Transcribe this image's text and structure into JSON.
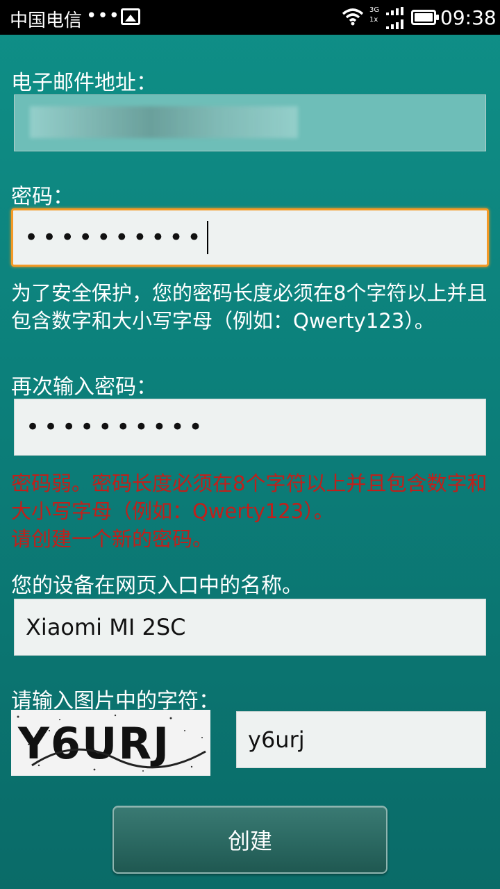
{
  "status_bar": {
    "carrier": "中国电信",
    "dots": "•••",
    "time": "09:38",
    "net_top": "3G",
    "net_bottom": "1x"
  },
  "form": {
    "email_label": "电子邮件地址：",
    "email_value": "",
    "password_label": "密码：",
    "password_value": "••••••••••",
    "password_hint": "为了安全保护，您的密码长度必须在8个字符以上并且包含数字和大小写字母（例如：Qwerty123）。",
    "confirm_label": "再次输入密码：",
    "confirm_value": "••••••••••",
    "error_text_line1": "密码弱。密码长度必须在8个字符以上并且包含数字和大小写字母（例如：Qwerty123）。",
    "error_text_line2": "请创建一个新的密码。",
    "device_label": "您的设备在网页入口中的名称。",
    "device_value": "Xiaomi MI 2SC",
    "captcha_label": "请输入图片中的字符：",
    "captcha_image_text": "Y6URJ",
    "captcha_value": "y6urj",
    "create_button": "创建"
  },
  "colors": {
    "background": "#0c7f7a",
    "focus_border": "#f39a26",
    "error": "#c0201b"
  }
}
